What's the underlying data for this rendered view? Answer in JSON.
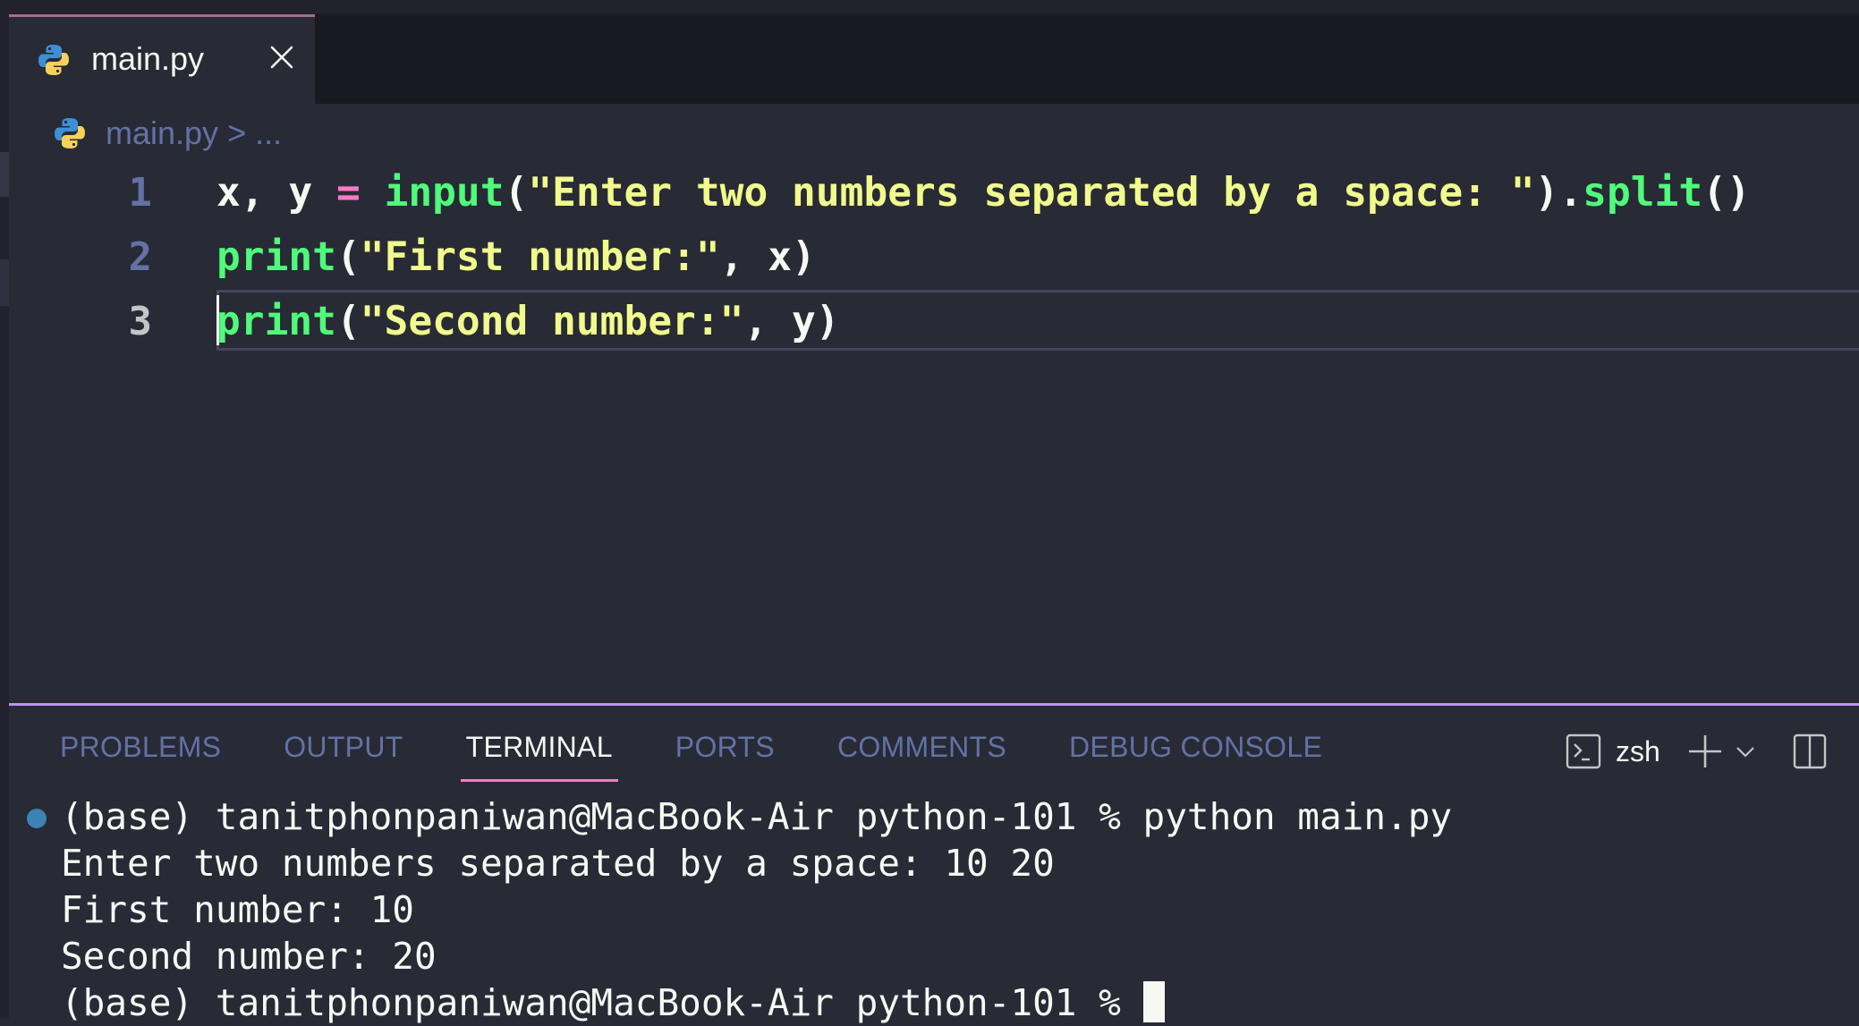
{
  "editor_tab": {
    "filename": "main.py",
    "icon": "python-icon",
    "close_icon": "close-icon"
  },
  "breadcrumb": {
    "file": "main.py",
    "separator": ">",
    "more": "..."
  },
  "code": {
    "active_line": 3,
    "lines": [
      {
        "number": "1",
        "tokens": [
          {
            "text": "x, y ",
            "type": "plain"
          },
          {
            "text": "=",
            "type": "op"
          },
          {
            "text": " ",
            "type": "plain"
          },
          {
            "text": "input",
            "type": "fn"
          },
          {
            "text": "(",
            "type": "plain"
          },
          {
            "text": "\"Enter two numbers separated by a space: \"",
            "type": "str"
          },
          {
            "text": ").",
            "type": "plain"
          },
          {
            "text": "split",
            "type": "fn"
          },
          {
            "text": "()",
            "type": "plain"
          }
        ]
      },
      {
        "number": "2",
        "tokens": [
          {
            "text": "print",
            "type": "fn"
          },
          {
            "text": "(",
            "type": "plain"
          },
          {
            "text": "\"First number:\"",
            "type": "str"
          },
          {
            "text": ", x)",
            "type": "plain"
          }
        ]
      },
      {
        "number": "3",
        "tokens": [
          {
            "text": "print",
            "type": "fn"
          },
          {
            "text": "(",
            "type": "plain"
          },
          {
            "text": "\"Second number:\"",
            "type": "str"
          },
          {
            "text": ", y)",
            "type": "plain"
          }
        ]
      }
    ]
  },
  "panel": {
    "tabs": [
      {
        "label": "PROBLEMS",
        "active": false
      },
      {
        "label": "OUTPUT",
        "active": false
      },
      {
        "label": "TERMINAL",
        "active": true
      },
      {
        "label": "PORTS",
        "active": false
      },
      {
        "label": "COMMENTS",
        "active": false
      },
      {
        "label": "DEBUG CONSOLE",
        "active": false
      }
    ],
    "shell_name": "zsh",
    "toolbar_icons": [
      "terminal-icon",
      "plus-icon",
      "chevron-down-icon",
      "split-panel-icon"
    ]
  },
  "terminal": {
    "lines": [
      "(base) tanitphonpaniwan@MacBook-Air python-101 % python main.py",
      "Enter two numbers separated by a space: 10 20",
      "First number: 10",
      "Second number: 20",
      "(base) tanitphonpaniwan@MacBook-Air python-101 % "
    ],
    "status_dot_color": "#3c83b3"
  },
  "theme": {
    "accent_pink": "#ff79c6",
    "accent_purple": "#bd93f9",
    "function_green": "#50fa7b",
    "string_yellow": "#f1fa8c",
    "comment_blue": "#6272a4",
    "background": "#282a36"
  }
}
